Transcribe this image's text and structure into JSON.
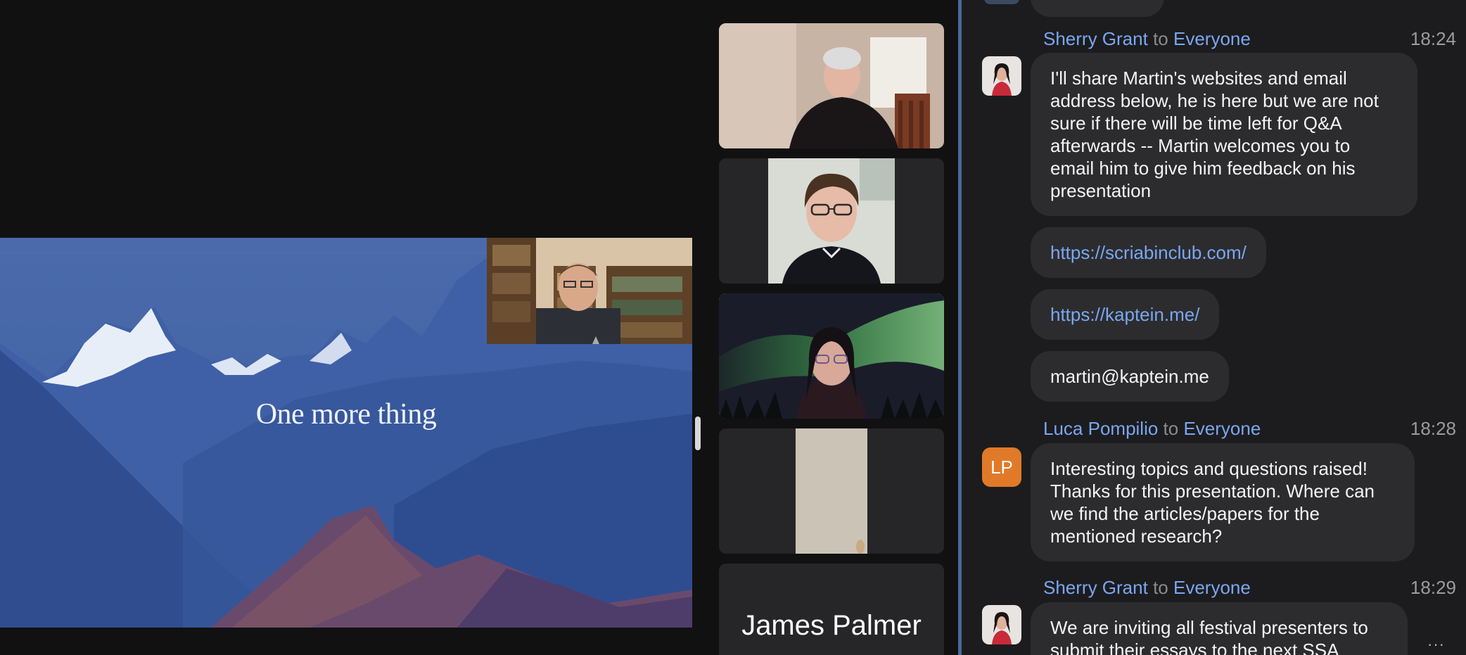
{
  "slide": {
    "title": "One more thing"
  },
  "gallery": {
    "tiles": [
      {
        "label": ""
      },
      {
        "label": ""
      },
      {
        "label": ""
      },
      {
        "label": ""
      },
      {
        "label": "James Palmer"
      }
    ]
  },
  "chat": {
    "messages": [
      {
        "sender": "Sherry Grant",
        "to_word": "to",
        "recipient": "Everyone",
        "time": "18:24",
        "bubbles": [
          "I'll share Martin's websites and email address below, he is here but we are not sure if there will be time left for Q&A afterwards -- Martin welcomes you to email him to give him feedback on his presentation",
          "https://scriabinclub.com/",
          "https://kaptein.me/",
          "martin@kaptein.me"
        ]
      },
      {
        "sender": "Luca Pompilio",
        "to_word": "to",
        "recipient": "Everyone",
        "time": "18:28",
        "initials": "LP",
        "bubbles": [
          "Interesting topics and questions raised! Thanks for this presentation. Where can we find the articles/papers for the mentioned research?"
        ]
      },
      {
        "sender": "Sherry Grant",
        "to_word": "to",
        "recipient": "Everyone",
        "time": "18:29",
        "bubbles": [
          "We are inviting all festival presenters to submit their essays to the next SSA"
        ]
      }
    ],
    "more_label": "···"
  },
  "colors": {
    "active_speaker_border": "#71d66c",
    "link": "#7aa7f0",
    "avatar_lp": "#e07a28"
  }
}
